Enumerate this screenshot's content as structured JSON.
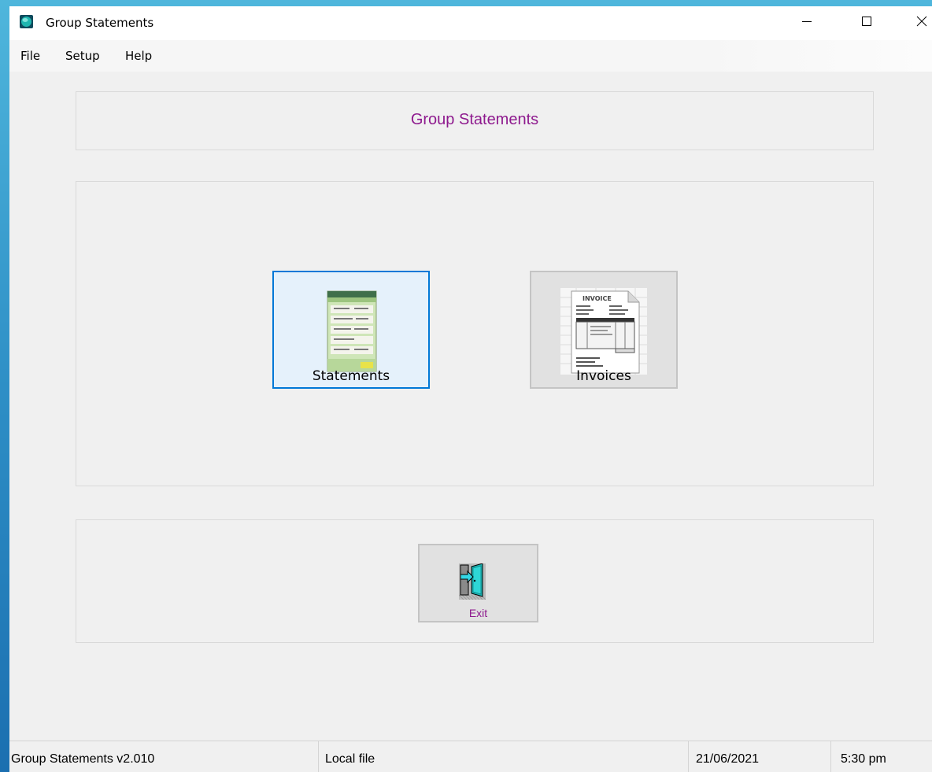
{
  "window": {
    "title": "Group Statements",
    "icon": "app-globe-icon",
    "controls": {
      "minimize": "minimize-icon",
      "maximize": "maximize-icon",
      "close": "close-icon"
    }
  },
  "menubar": {
    "items": [
      {
        "label": "File"
      },
      {
        "label": "Setup"
      },
      {
        "label": "Help"
      }
    ]
  },
  "header": {
    "title": "Group Statements",
    "color": "#8e1a8e"
  },
  "main": {
    "statements": {
      "label": "Statements",
      "icon": "statements-document-icon"
    },
    "invoices": {
      "label": "Invoices",
      "icon": "invoice-document-icon",
      "image_text": "INVOICE"
    }
  },
  "footer": {
    "exit": {
      "label": "Exit",
      "icon": "exit-door-icon"
    }
  },
  "statusbar": {
    "app_version": "Group Statements v2.010",
    "source": "Local file",
    "date": "21/06/2021",
    "time": "5:30 pm"
  },
  "colors": {
    "accent_purple": "#8e1a8e",
    "focus_blue": "#0078d7",
    "window_bg": "#f0f0f0"
  }
}
